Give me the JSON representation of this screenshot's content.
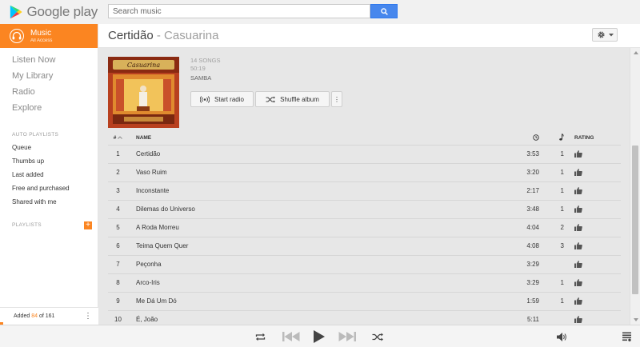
{
  "app": {
    "logo_text": "Google play"
  },
  "search": {
    "placeholder": "Search music"
  },
  "sidebar": {
    "music": {
      "title": "Music",
      "subtitle": "All Access"
    },
    "main_nav": [
      {
        "label": "Listen Now"
      },
      {
        "label": "My Library"
      },
      {
        "label": "Radio"
      },
      {
        "label": "Explore"
      }
    ],
    "auto_playlists_heading": "AUTO PLAYLISTS",
    "auto_playlists": [
      {
        "label": "Queue"
      },
      {
        "label": "Thumbs up"
      },
      {
        "label": "Last added"
      },
      {
        "label": "Free and purchased"
      },
      {
        "label": "Shared with me"
      }
    ],
    "playlists_heading": "PLAYLISTS",
    "add_playlist_symbol": "+",
    "added": {
      "prefix": "Added",
      "count": "84",
      "middle": "of",
      "total": "161"
    },
    "more_symbol": "⋮"
  },
  "album": {
    "title": "Certidão",
    "separator": "-",
    "artist": "Casuarina",
    "song_count": "14 SONGS",
    "duration": "50:19",
    "genre": "SAMBA",
    "cover_text": "Casuarina",
    "start_radio_label": "Start radio",
    "shuffle_label": "Shuffle album",
    "more_symbol": "⋮"
  },
  "tracks_header": {
    "num": "#",
    "name": "NAME",
    "rating": "RATING"
  },
  "tracks": [
    {
      "num": "1",
      "name": "Certidão",
      "time": "3:53",
      "plays": "1"
    },
    {
      "num": "2",
      "name": "Vaso Ruim",
      "time": "3:20",
      "plays": "1"
    },
    {
      "num": "3",
      "name": "Inconstante",
      "time": "2:17",
      "plays": "1"
    },
    {
      "num": "4",
      "name": "Dilemas do Universo",
      "time": "3:48",
      "plays": "1"
    },
    {
      "num": "5",
      "name": "A Roda Morreu",
      "time": "4:04",
      "plays": "2"
    },
    {
      "num": "6",
      "name": "Teima Quem Quer",
      "time": "4:08",
      "plays": "3"
    },
    {
      "num": "7",
      "name": "Peçonha",
      "time": "3:29",
      "plays": ""
    },
    {
      "num": "8",
      "name": "Arco-Iris",
      "time": "3:29",
      "plays": "1"
    },
    {
      "num": "9",
      "name": "Me Dá Um Dó",
      "time": "1:59",
      "plays": "1"
    },
    {
      "num": "10",
      "name": "É, João",
      "time": "5:11",
      "plays": ""
    }
  ],
  "colors": {
    "accent": "#fb8521",
    "search_button": "#4787ed"
  },
  "icons": {
    "logo": "play-store-icon",
    "search": "search-icon",
    "music": "headphones-icon",
    "gear": "gear-icon",
    "radio": "radio-icon",
    "shuffle": "shuffle-icon",
    "clock": "clock-icon",
    "note": "music-note-icon",
    "thumb": "thumbs-up-icon",
    "repeat": "repeat-icon",
    "previous": "previous-icon",
    "play": "play-icon",
    "next": "next-icon",
    "volume": "volume-icon",
    "queue": "queue-icon"
  }
}
